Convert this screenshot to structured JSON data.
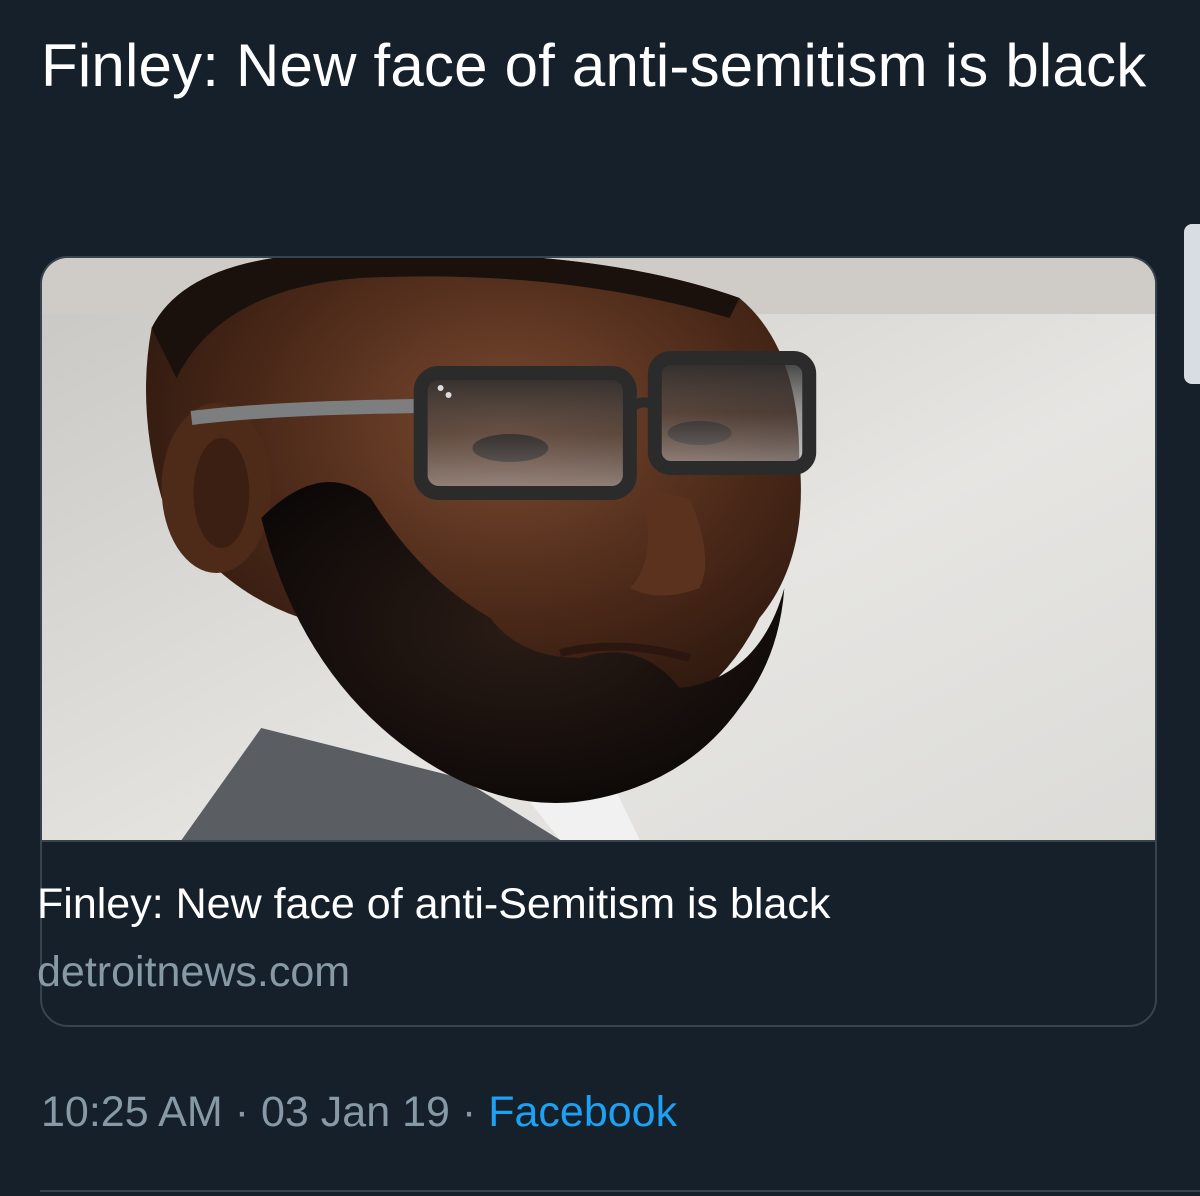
{
  "tweet": {
    "text": "Finley: New face of anti-semitism is black"
  },
  "card": {
    "image_alt": "Close-up portrait of a bearded man wearing glasses",
    "title": "Finley: New face of anti-Semitism is black",
    "domain": "detroitnews.com"
  },
  "meta": {
    "time": "10:25 AM",
    "date": "03 Jan 19",
    "separator": "·",
    "source": "Facebook"
  },
  "colors": {
    "background": "#15202b",
    "border": "#38444d",
    "muted_text": "#8899a6",
    "link": "#1da1f2"
  }
}
